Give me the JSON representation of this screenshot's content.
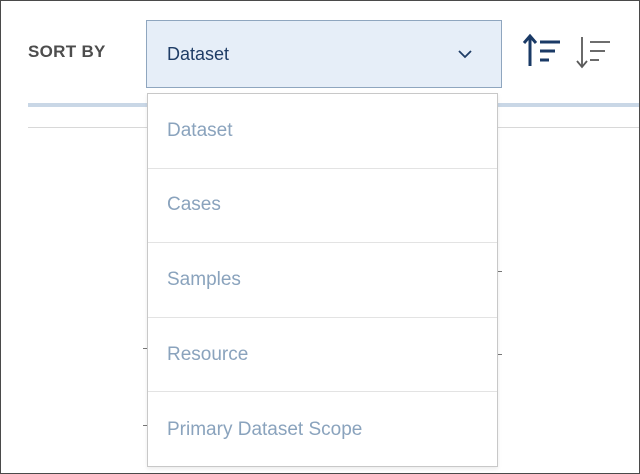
{
  "sort": {
    "label": "SORT BY",
    "selected": "Dataset",
    "options": [
      "Dataset",
      "Cases",
      "Samples",
      "Resource",
      "Primary Dataset Scope"
    ]
  },
  "icons": {
    "chevron": "chevron-down-icon",
    "ascending": "sort-ascending-icon",
    "descending": "sort-descending-icon"
  },
  "colors": {
    "select_bg": "#e6eef8",
    "select_text": "#1f3d66",
    "option_text": "#8aa3bd",
    "icon": "#1a3a66"
  }
}
